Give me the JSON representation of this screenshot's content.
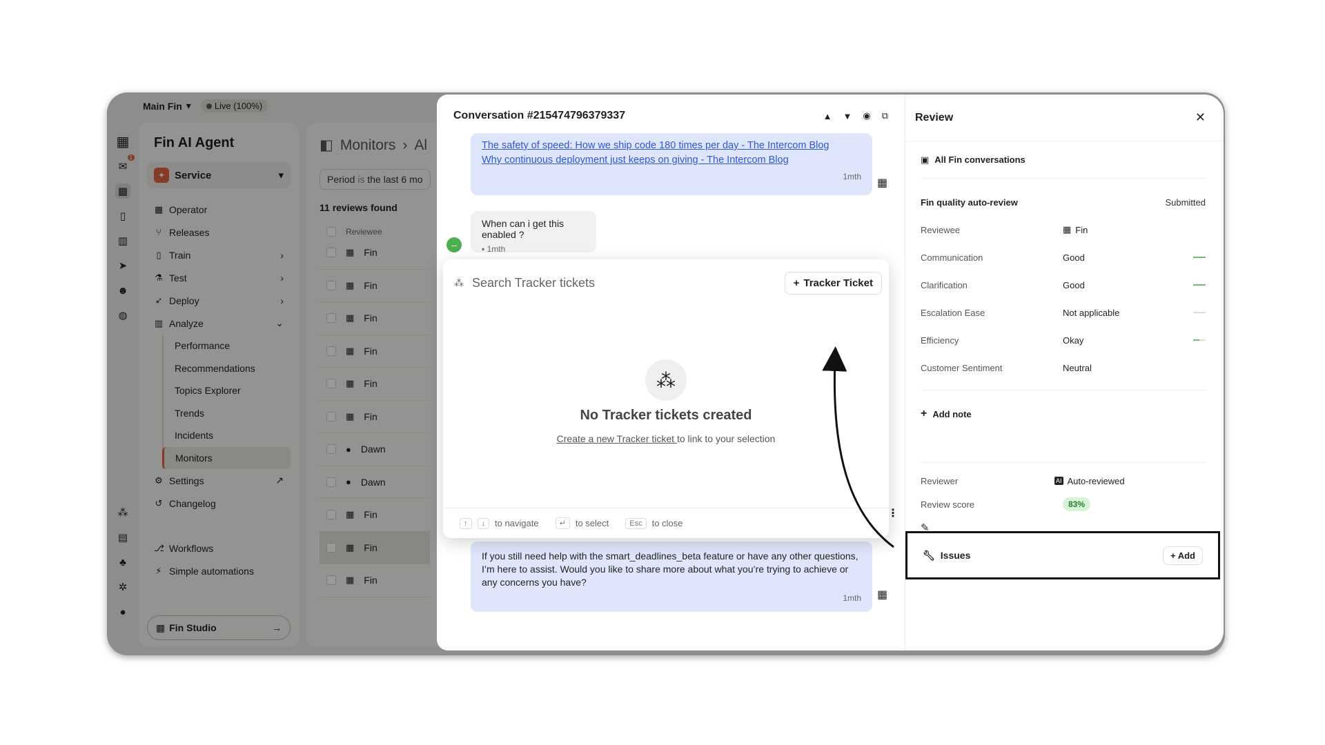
{
  "topbar": {
    "workspace": "Main Fin",
    "status": "Live (100%)"
  },
  "rail": {
    "notif_count": "1"
  },
  "nav": {
    "title": "Fin AI Agent",
    "service": "Service",
    "items": [
      {
        "label": "Operator"
      },
      {
        "label": "Releases"
      },
      {
        "label": "Train"
      },
      {
        "label": "Test"
      },
      {
        "label": "Deploy"
      },
      {
        "label": "Analyze"
      }
    ],
    "analyze_sub": [
      {
        "label": "Performance"
      },
      {
        "label": "Recommendations"
      },
      {
        "label": "Topics Explorer"
      },
      {
        "label": "Trends"
      },
      {
        "label": "Incidents"
      },
      {
        "label": "Monitors"
      }
    ],
    "settings": "Settings",
    "changelog": "Changelog",
    "workflows": "Workflows",
    "simple_automations": "Simple automations",
    "studio": "Fin Studio"
  },
  "list": {
    "crumb_a": "Monitors",
    "crumb_b": "Al",
    "period_key": "Period",
    "period_op": "is",
    "period_val": "the last 6 mo",
    "found": "11 reviews found",
    "col_reviewee": "Reviewee",
    "rows": [
      "Fin",
      "Fin",
      "Fin",
      "Fin",
      "Fin",
      "Fin",
      "Dawn",
      "Dawn",
      "Fin",
      "Fin",
      "Fin"
    ]
  },
  "conversation": {
    "title": "Conversation #215474796379337",
    "link1": "The safety of speed: How we ship code 180 times per day - The Intercom Blog",
    "link2": "Why continuous deployment just keeps on giving - The Intercom Blog",
    "ts1": "1mth",
    "user_msg": "When can i get this enabled ?",
    "user_ts": "1mth",
    "bot_msg": "If you still need help with the smart_deadlines_beta feature or have any other questions, I’m here to assist. Would you like to share more about what you’re trying to achieve or any concerns you have?",
    "ts2": "1mth"
  },
  "tracker": {
    "placeholder": "Search Tracker tickets",
    "add_btn": "Tracker Ticket",
    "empty_title": "No Tracker tickets created",
    "empty_link": "Create a new Tracker ticket ",
    "empty_rest": "to link to your selection",
    "hint_nav": "to navigate",
    "hint_select": "to select",
    "hint_esc_key": "Esc",
    "hint_close": "to close"
  },
  "review": {
    "title": "Review",
    "all_conv": "All Fin conversations",
    "auto_review": "Fin quality auto-review",
    "status": "Submitted",
    "rows": [
      {
        "k": "Reviewee",
        "v": "Fin"
      },
      {
        "k": "Communication",
        "v": "Good"
      },
      {
        "k": "Clarification",
        "v": "Good"
      },
      {
        "k": "Escalation Ease",
        "v": "Not applicable"
      },
      {
        "k": "Efficiency",
        "v": "Okay"
      },
      {
        "k": "Customer Sentiment",
        "v": "Neutral"
      }
    ],
    "add_note": "Add note",
    "reviewer_k": "Reviewer",
    "reviewer_v": "Auto-reviewed",
    "score_k": "Review score",
    "score_v": "83%",
    "issues": "Issues",
    "add": "Add"
  },
  "colors": {
    "accent": "#e0633e",
    "bot_bubble": "#dfe6fb",
    "score_bg": "#d7f3d5",
    "positive": "#6cc070"
  }
}
